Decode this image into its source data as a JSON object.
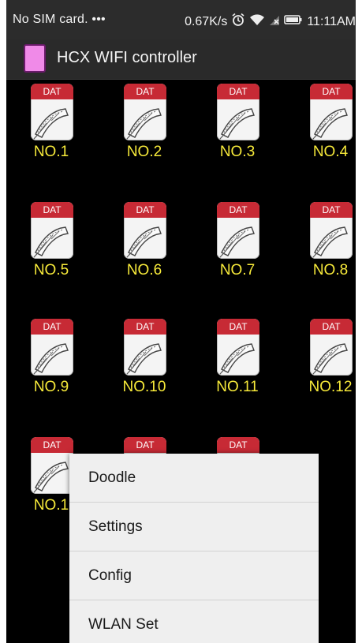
{
  "statusbar": {
    "carrier": "No SIM card. •••",
    "speed": "0.67K/s",
    "time": "11:11AM",
    "icons": [
      "alarm-icon",
      "wifi-icon",
      "signal-off-icon",
      "battery-icon"
    ]
  },
  "actionbar": {
    "title": "HCX WIFI controller",
    "icon": "app-icon",
    "icon_color": "#f08ae8"
  },
  "grid": {
    "file_badge": "DAT",
    "icon": "film-file-icon",
    "label_color": "#f7ea3a",
    "items": [
      {
        "label": "NO.1"
      },
      {
        "label": "NO.2"
      },
      {
        "label": "NO.3"
      },
      {
        "label": "NO.4"
      },
      {
        "label": "NO.5"
      },
      {
        "label": "NO.6"
      },
      {
        "label": "NO.7"
      },
      {
        "label": "NO.8"
      },
      {
        "label": "NO.9"
      },
      {
        "label": "NO.10"
      },
      {
        "label": "NO.11"
      },
      {
        "label": "NO.12"
      },
      {
        "label": "NO.1"
      },
      {
        "label": ""
      },
      {
        "label": ""
      }
    ]
  },
  "menu": {
    "items": [
      {
        "label": "Doodle"
      },
      {
        "label": "Settings"
      },
      {
        "label": "Config"
      },
      {
        "label": "WLAN Set"
      }
    ]
  }
}
